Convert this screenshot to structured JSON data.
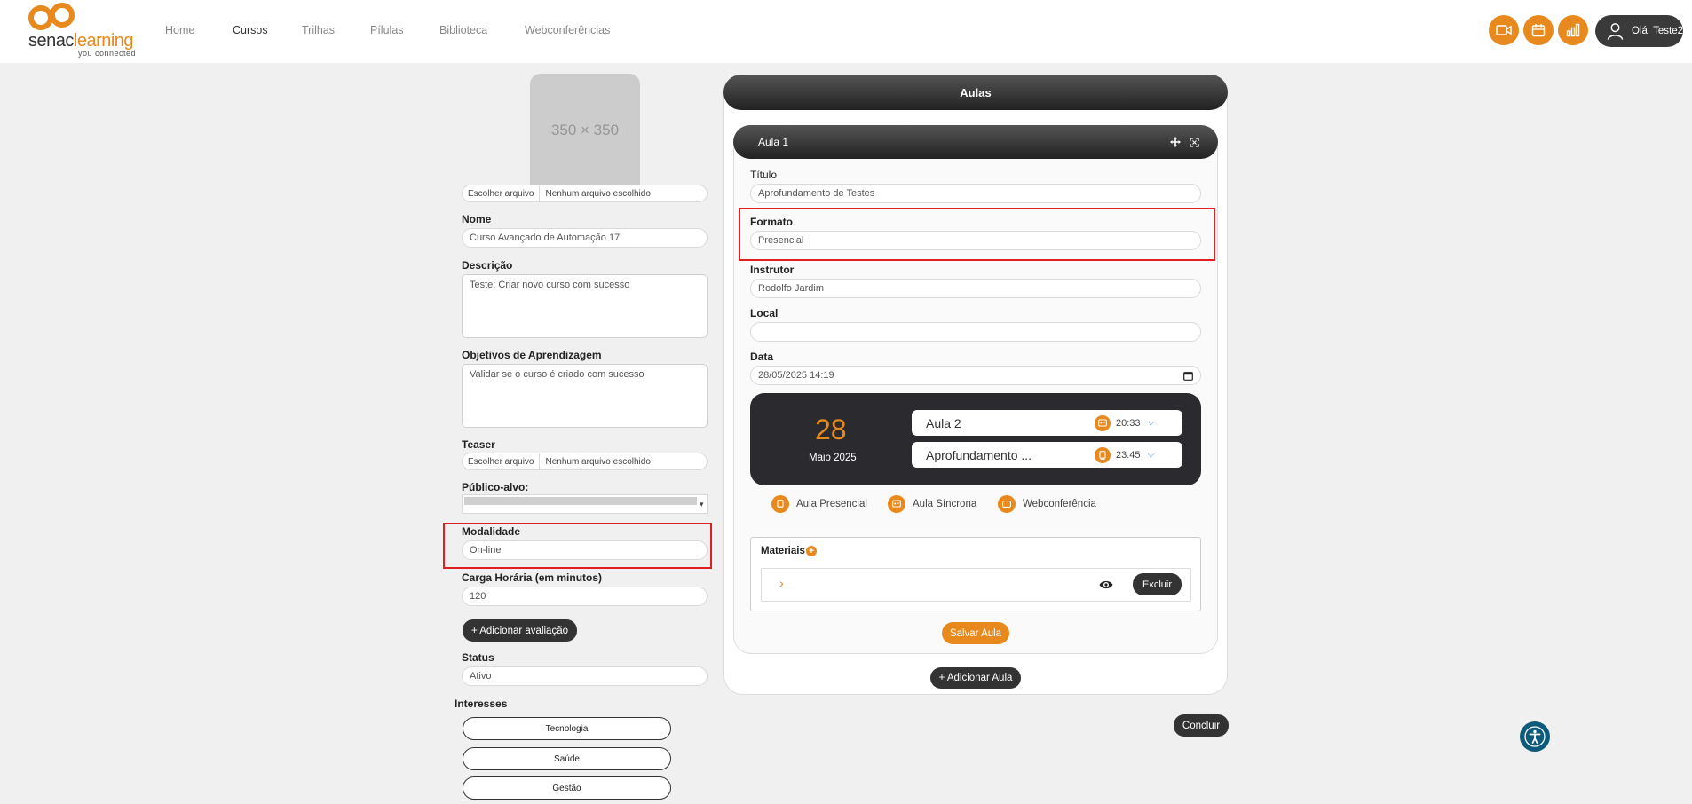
{
  "brand": {
    "word_a": "senac",
    "word_b": "learning",
    "tagline": "you connected",
    "accent": "#e8891d"
  },
  "nav": {
    "home": "Home",
    "cursos": "Cursos",
    "trilhas": "Trilhas",
    "pilulas": "Pílulas",
    "biblioteca": "Biblioteca",
    "webconferencias": "Webconferências"
  },
  "topbar": {
    "icons": [
      "video-icon",
      "calendar-icon",
      "chart-icon"
    ],
    "user_greeting": "Olá, Teste2"
  },
  "course": {
    "image_placeholder": "350 × 350",
    "image_file": {
      "button": "Escolher arquivo",
      "status": "Nenhum arquivo escolhido"
    },
    "nome_label": "Nome",
    "nome_value": "Curso Avançado de Automação 17",
    "descricao_label": "Descrição",
    "descricao_value": "Teste: Criar novo curso com sucesso",
    "objetivos_label": "Objetivos de Aprendizagem",
    "objetivos_value": "Validar se o curso é criado com sucesso",
    "teaser_label": "Teaser",
    "teaser_file": {
      "button": "Escolher arquivo",
      "status": "Nenhum arquivo escolhido"
    },
    "publico_label": "Público-alvo:",
    "modalidade_label": "Modalidade",
    "modalidade_value": "On-line",
    "carga_label": "Carga Horária (em minutos)",
    "carga_value": "120",
    "add_avaliacao": "+ Adicionar avaliação",
    "status_label": "Status",
    "status_value": "Ativo",
    "interesses_label": "Interesses",
    "interesses": [
      "Tecnologia",
      "Saúde",
      "Gestão"
    ]
  },
  "aulas": {
    "header": "Aulas",
    "aula_title": "Aula 1",
    "titulo_label": "Título",
    "titulo_value": "Aprofundamento de Testes",
    "formato_label": "Formato",
    "formato_value": "Presencial",
    "instrutor_label": "Instrutor",
    "instrutor_value": "Rodolfo Jardim",
    "local_label": "Local",
    "local_value": "",
    "data_label": "Data",
    "data_value": "28/05/2025 14:19",
    "calendar": {
      "day": "28",
      "month": "Maio 2025",
      "items": [
        {
          "title": "Aula 2",
          "icon": "sync-class-icon",
          "time": "20:33"
        },
        {
          "title": "Aprofundamento ...",
          "icon": "presencial-class-icon",
          "time": "23:45"
        }
      ]
    },
    "legend": [
      "Aula Presencial",
      "Aula Síncrona",
      "Webconferência"
    ],
    "materiais_label": "Materiais",
    "excluir": "Excluir",
    "salvar": "Salvar Aula",
    "adicionar": "+ Adicionar Aula",
    "concluir": "Concluir"
  }
}
